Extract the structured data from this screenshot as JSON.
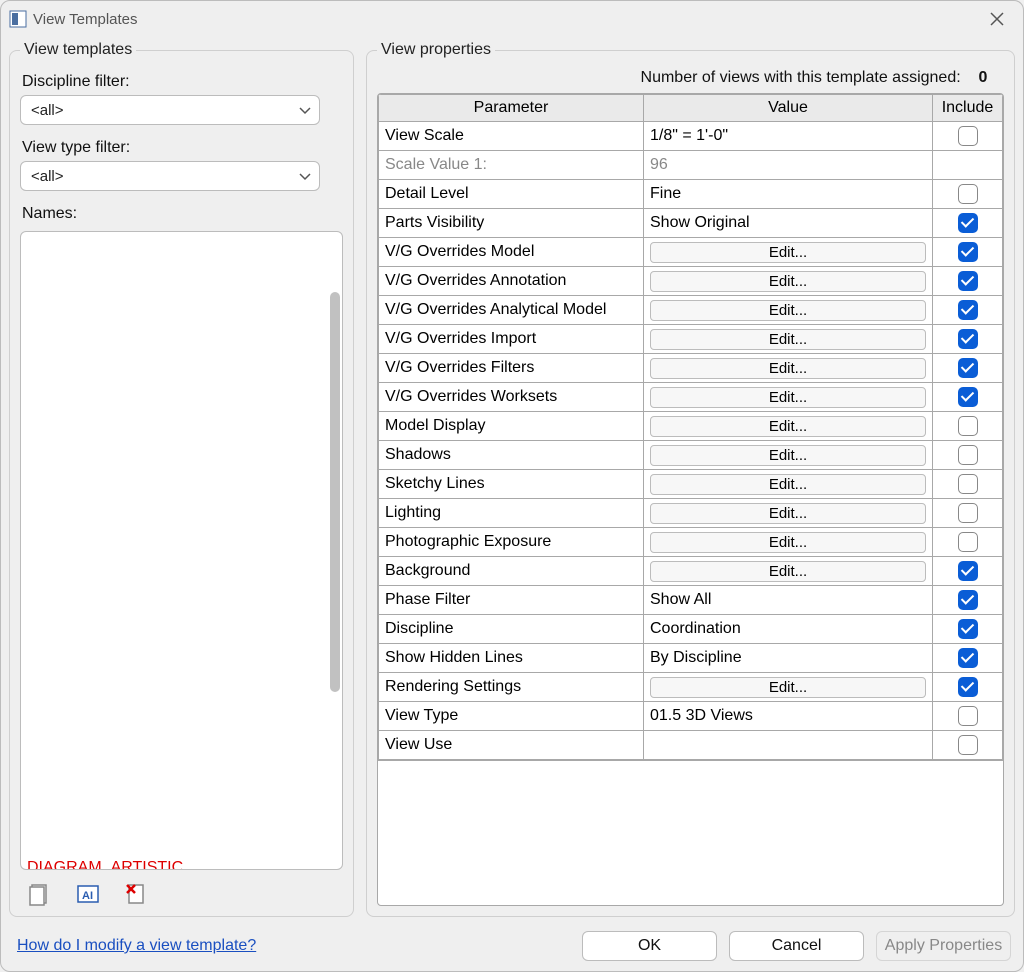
{
  "window": {
    "title": "View Templates"
  },
  "left": {
    "legend": "View templates",
    "discipline_label": "Discipline filter:",
    "discipline_value": "<all>",
    "viewtype_label": "View type filter:",
    "viewtype_value": "<all>",
    "names_label": "Names:",
    "hidden_red_item": "DIAGRAM_ARTISTIC",
    "icons": {
      "new": "new-template-icon",
      "rename": "rename-template-icon",
      "delete": "delete-template-icon"
    }
  },
  "right": {
    "legend": "View properties",
    "assigned_label": "Number of views with this template assigned:",
    "assigned_count": "0",
    "headers": {
      "param": "Parameter",
      "value": "Value",
      "include": "Include"
    },
    "edit_label": "Edit...",
    "rows": [
      {
        "param": "View Scale",
        "value": "1/8\" = 1'-0\"",
        "kind": "text",
        "include": false,
        "grey": false
      },
      {
        "param": "Scale Value    1:",
        "value": "96",
        "kind": "text",
        "include": null,
        "grey": true
      },
      {
        "param": "Detail Level",
        "value": "Fine",
        "kind": "text",
        "include": false,
        "grey": false
      },
      {
        "param": "Parts Visibility",
        "value": "Show Original",
        "kind": "text",
        "include": true,
        "grey": false
      },
      {
        "param": "V/G Overrides Model",
        "value": "",
        "kind": "edit",
        "include": true,
        "grey": false
      },
      {
        "param": "V/G Overrides Annotation",
        "value": "",
        "kind": "edit",
        "include": true,
        "grey": false
      },
      {
        "param": "V/G Overrides Analytical Model",
        "value": "",
        "kind": "edit",
        "include": true,
        "grey": false
      },
      {
        "param": "V/G Overrides Import",
        "value": "",
        "kind": "edit",
        "include": true,
        "grey": false
      },
      {
        "param": "V/G Overrides Filters",
        "value": "",
        "kind": "edit",
        "include": true,
        "grey": false
      },
      {
        "param": "V/G Overrides Worksets",
        "value": "",
        "kind": "edit",
        "include": true,
        "grey": false
      },
      {
        "param": "Model Display",
        "value": "",
        "kind": "edit",
        "include": false,
        "grey": false
      },
      {
        "param": "Shadows",
        "value": "",
        "kind": "edit",
        "include": false,
        "grey": false
      },
      {
        "param": "Sketchy Lines",
        "value": "",
        "kind": "edit",
        "include": false,
        "grey": false
      },
      {
        "param": "Lighting",
        "value": "",
        "kind": "edit",
        "include": false,
        "grey": false
      },
      {
        "param": "Photographic Exposure",
        "value": "",
        "kind": "edit",
        "include": false,
        "grey": false
      },
      {
        "param": "Background",
        "value": "",
        "kind": "edit",
        "include": true,
        "grey": false
      },
      {
        "param": "Phase Filter",
        "value": "Show All",
        "kind": "text",
        "include": true,
        "grey": false
      },
      {
        "param": "Discipline",
        "value": "Coordination",
        "kind": "text",
        "include": true,
        "grey": false
      },
      {
        "param": "Show Hidden Lines",
        "value": "By Discipline",
        "kind": "text",
        "include": true,
        "grey": false
      },
      {
        "param": "Rendering Settings",
        "value": "",
        "kind": "edit",
        "include": true,
        "grey": false
      },
      {
        "param": "View Type",
        "value": "01.5 3D Views",
        "kind": "text",
        "include": false,
        "grey": false
      },
      {
        "param": "View Use",
        "value": "",
        "kind": "text",
        "include": false,
        "grey": false
      }
    ]
  },
  "footer": {
    "help": "How do I modify a view template?",
    "ok": "OK",
    "cancel": "Cancel",
    "apply": "Apply Properties"
  }
}
